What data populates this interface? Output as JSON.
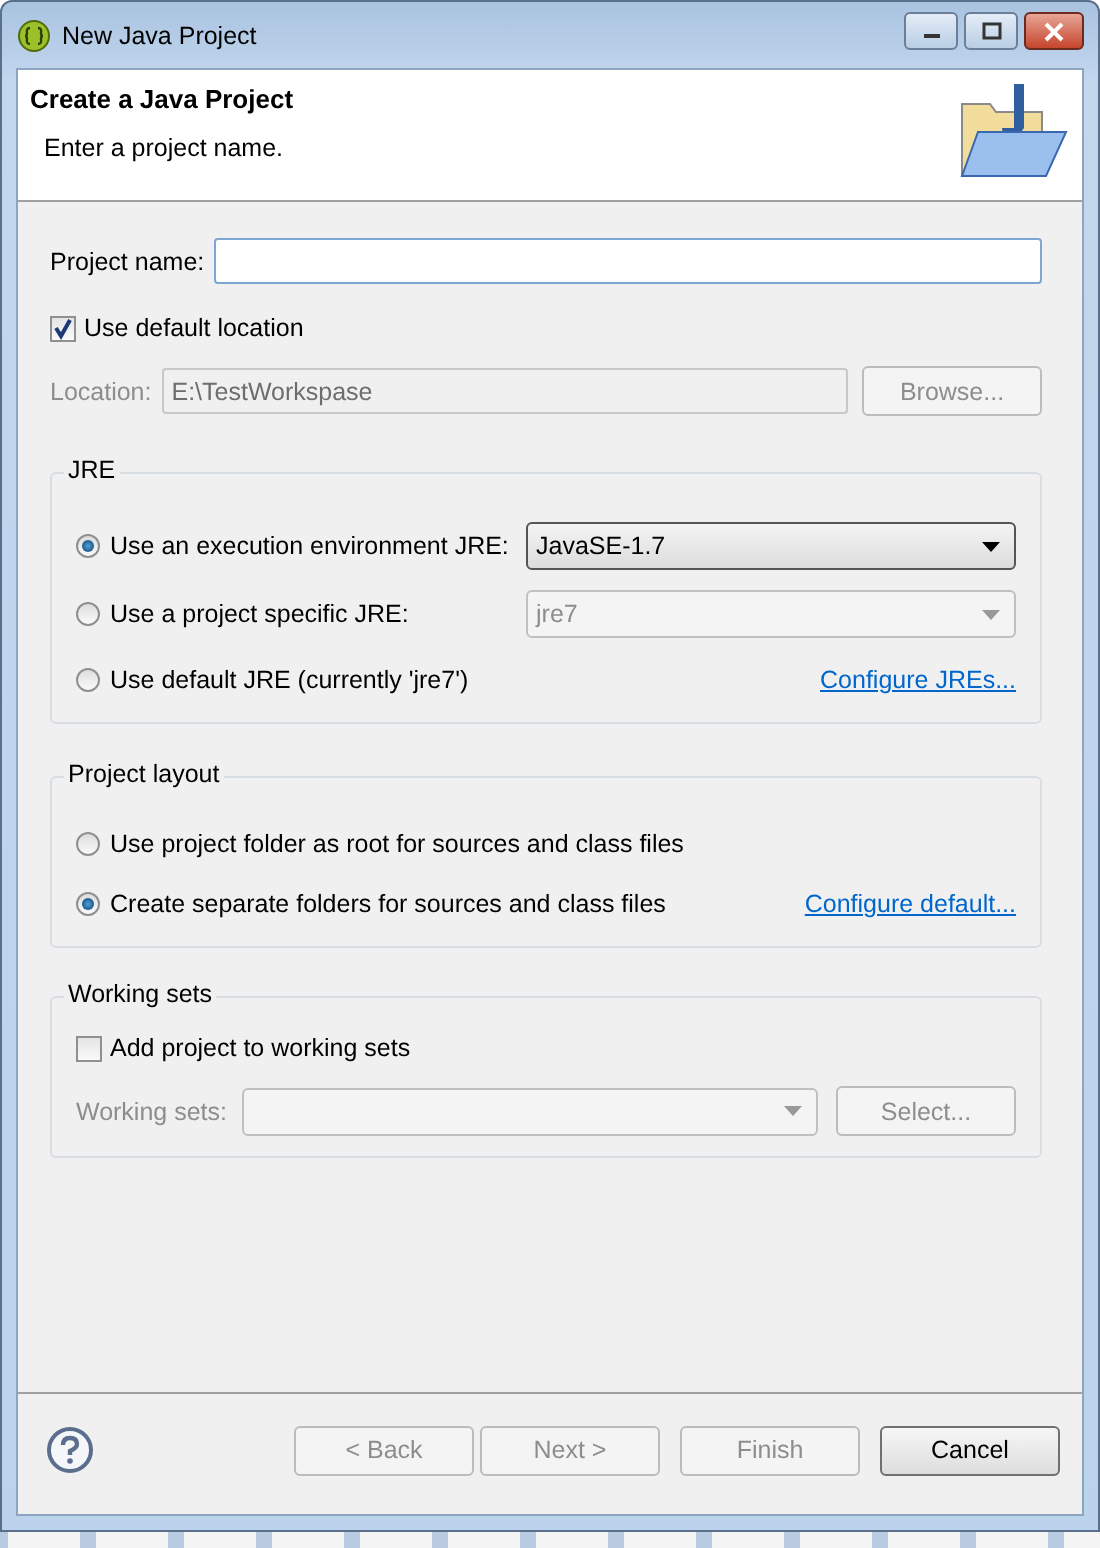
{
  "window": {
    "title": "New Java Project"
  },
  "header": {
    "title": "Create a Java Project",
    "message": "Enter a project name."
  },
  "project_name": {
    "label": "Project name:"
  },
  "default_location": {
    "label": "Use default location",
    "checked": true
  },
  "location": {
    "label": "Location:",
    "value": "E:\\TestWorkspase",
    "button": "Browse..."
  },
  "jre": {
    "title": "JRE",
    "options": [
      {
        "label": "Use an execution environment JRE:",
        "selected": true,
        "kind": "combo",
        "value": "JavaSE-1.7"
      },
      {
        "label": "Use a project specific JRE:",
        "selected": false,
        "kind": "combo",
        "value": "jre7"
      },
      {
        "label": "Use default JRE (currently 'jre7')",
        "selected": false,
        "kind": "link",
        "link": "Configure JREs..."
      }
    ]
  },
  "project_layout": {
    "title": "Project layout",
    "options": [
      {
        "label": "Use project folder as root for sources and class files",
        "selected": false
      },
      {
        "label": "Create separate folders for sources and class files",
        "selected": true,
        "link": "Configure default..."
      }
    ]
  },
  "working_sets": {
    "title": "Working sets",
    "add": {
      "label": "Add project to working sets",
      "checked": false
    },
    "label": "Working sets:",
    "button": "Select..."
  },
  "buttons": [
    {
      "label": "< Back",
      "disabled": true
    },
    {
      "label": "Next >",
      "disabled": true
    },
    {
      "label": "Finish",
      "disabled": true
    },
    {
      "label": "Cancel",
      "disabled": false
    }
  ]
}
